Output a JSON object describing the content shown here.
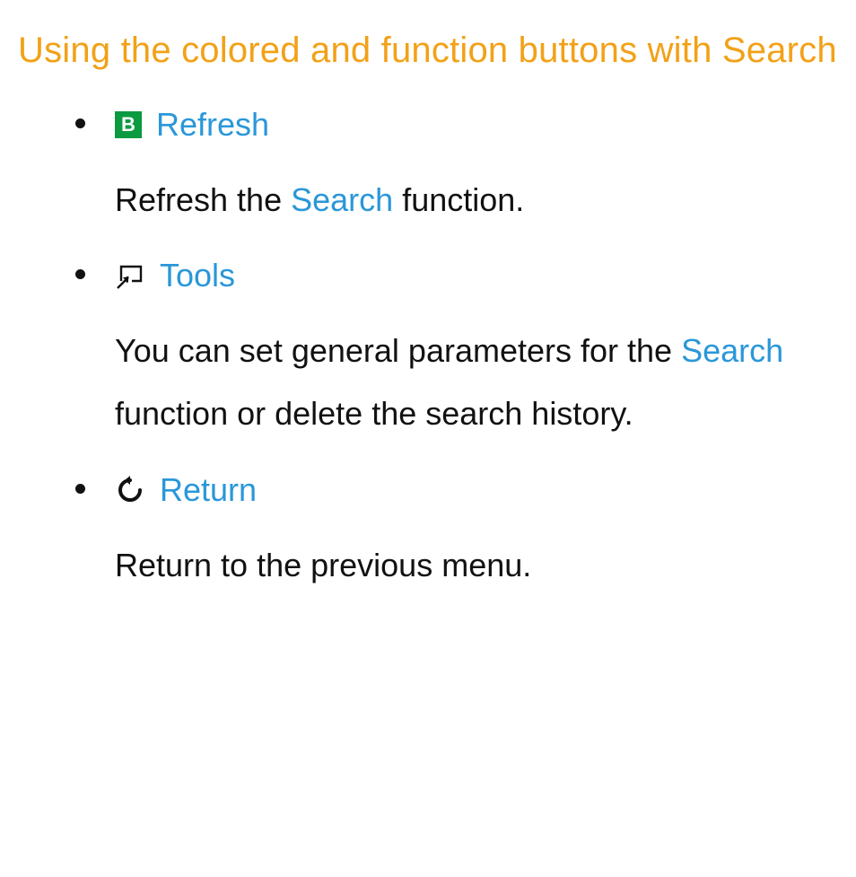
{
  "heading": "Using the colored and function buttons with Search",
  "items": [
    {
      "icon": "b-button-icon",
      "title": "Refresh",
      "desc_pre": "Refresh the ",
      "keyword": "Search",
      "desc_post": " function."
    },
    {
      "icon": "tools-icon",
      "title": "Tools",
      "desc_pre": "You can set general parameters for the ",
      "keyword": "Search",
      "desc_post": " function or delete the search history."
    },
    {
      "icon": "return-icon",
      "title": "Return",
      "desc_pre": "Return to the previous menu.",
      "keyword": "",
      "desc_post": ""
    }
  ]
}
